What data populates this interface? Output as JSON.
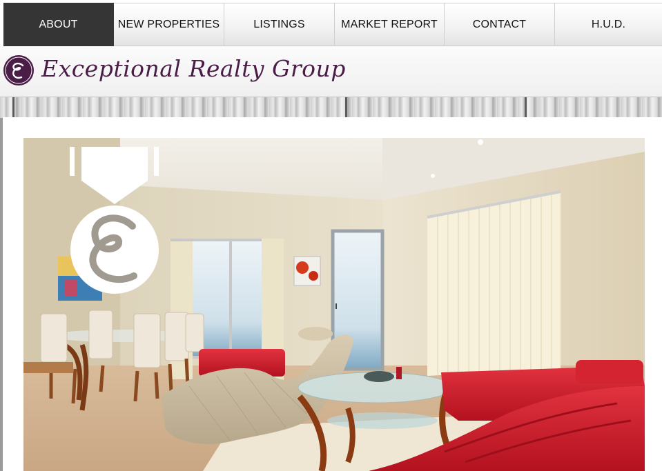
{
  "nav": {
    "items": [
      {
        "label": "ABOUT",
        "active": true
      },
      {
        "label": "NEW PROPERTIES",
        "active": false
      },
      {
        "label": "LISTINGS",
        "active": false
      },
      {
        "label": "MARKET REPORT",
        "active": false
      },
      {
        "label": "CONTACT",
        "active": false
      },
      {
        "label": "H.U.D.",
        "active": false
      }
    ]
  },
  "header": {
    "brand_name": "Exceptional Realty Group",
    "logo_letter": "e"
  },
  "hero": {
    "badge_letter": "e"
  },
  "colors": {
    "nav_active": "#353535",
    "brand_purple": "#4a1d47",
    "sofa_red": "#d41e2c"
  }
}
